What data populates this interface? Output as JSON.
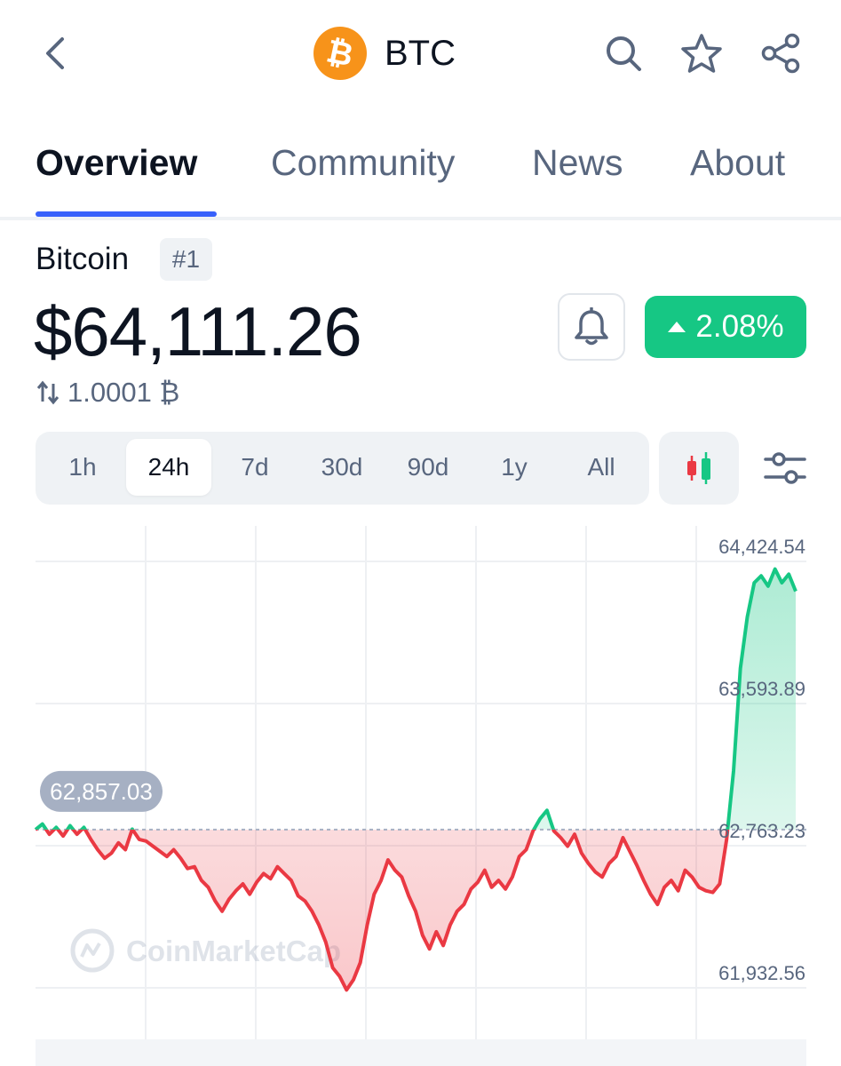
{
  "header": {
    "symbol": "BTC",
    "logo_glyph": "₿",
    "icons": [
      "back-arrow-icon",
      "search-icon",
      "star-icon",
      "share-icon"
    ]
  },
  "tabs": [
    {
      "label": "Overview",
      "active": true
    },
    {
      "label": "Community",
      "active": false
    },
    {
      "label": "News",
      "active": false
    },
    {
      "label": "About",
      "active": false
    }
  ],
  "coin": {
    "name": "Bitcoin",
    "rank": "#1",
    "price": "$64,111.26",
    "btc_amount": "1.0001 ₿",
    "change": "2.08%",
    "change_direction": "up"
  },
  "range": {
    "options": [
      "1h",
      "24h",
      "7d",
      "30d",
      "90d",
      "1y",
      "All"
    ],
    "selected": "24h"
  },
  "colors": {
    "accent": "#3861fb",
    "up": "#16c784",
    "down": "#ea3943",
    "text_primary": "#0d1421",
    "text_secondary": "#58667e",
    "btc_orange": "#f7931a"
  },
  "chart_data": {
    "type": "line",
    "y_ticks": [
      "64,424.54",
      "63,593.89",
      "62,763.23",
      "61,932.56"
    ],
    "ylim": [
      61932.56,
      64424.54
    ],
    "reference_price": 62857.03,
    "reference_label": "62,857.03",
    "watermark": "CoinMarketCap",
    "grid": true,
    "series": [
      {
        "values": [
          62857,
          62890,
          62830,
          62870,
          62820,
          62880,
          62830,
          62870,
          62800,
          62740,
          62690,
          62720,
          62780,
          62740,
          62860,
          62800,
          62790,
          62760,
          62730,
          62700,
          62740,
          62690,
          62630,
          62640,
          62560,
          62520,
          62440,
          62380,
          62450,
          62500,
          62540,
          62480,
          62550,
          62600,
          62570,
          62640,
          62600,
          62560,
          62470,
          62440,
          62380,
          62300,
          62200,
          62050,
          62000,
          61920,
          61980,
          62080,
          62300,
          62480,
          62560,
          62680,
          62620,
          62580,
          62470,
          62380,
          62240,
          62160,
          62260,
          62180,
          62300,
          62380,
          62420,
          62510,
          62550,
          62620,
          62520,
          62560,
          62510,
          62580,
          62700,
          62740,
          62850,
          62920,
          62970,
          62850,
          62810,
          62760,
          62830,
          62720,
          62660,
          62610,
          62580,
          62660,
          62700,
          62810,
          62730,
          62650,
          62560,
          62480,
          62420,
          62520,
          62560,
          62500,
          62620,
          62580,
          62520,
          62500,
          62490,
          62540,
          62800,
          63200,
          63800,
          64100,
          64300,
          64340,
          64280,
          64380,
          64300,
          64350,
          64250
        ]
      }
    ]
  }
}
